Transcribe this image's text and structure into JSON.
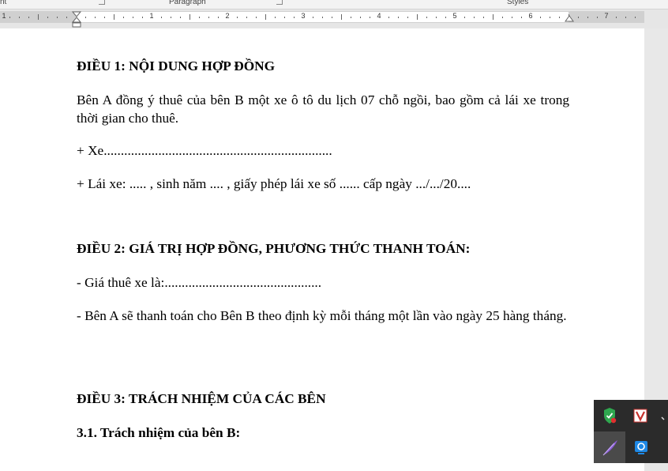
{
  "ribbon": {
    "group_font_partial": "nt",
    "group_paragraph": "Paragraph",
    "group_styles": "Styles"
  },
  "ruler": {
    "numbers": [
      "1",
      "1",
      "2",
      "3",
      "4",
      "5",
      "6",
      "7"
    ]
  },
  "document": {
    "article1_heading": "ĐIỀU 1: NỘI DUNG HỢP ĐỒNG",
    "article1_para": "Bên A đồng ý thuê của bên B một xe ô tô du lịch 07 chỗ ngồi, bao gồm cả lái xe trong thời gian cho thuê.",
    "article1_car": "+ Xe...................................................................",
    "article1_driver": "+ Lái xe: ..... , sinh năm .... , giấy phép lái xe số ......  cấp ngày .../.../20....",
    "article2_heading": "ĐIỀU 2: GIÁ TRỊ HỢP ĐỒNG, PHƯƠNG THỨC THANH TOÁN:",
    "article2_price": "- Giá thuê xe là:..............................................",
    "article2_payment": "- Bên A sẽ thanh toán cho Bên B theo định kỳ mỗi tháng một lần vào ngày 25 hàng tháng.",
    "article3_heading": "ĐIỀU 3: TRÁCH NHIỆM CỦA CÁC BÊN",
    "article3_1_heading": "3.1. Trách nhiệm của bên B:"
  },
  "tray": {
    "icons": [
      "security-shield-icon",
      "vivaldi-v-icon",
      "pen-feather-icon",
      "network-status-icon"
    ]
  },
  "colors": {
    "page_background": "#ffffff",
    "app_background": "#e6e6e6",
    "tray_background": "#2b2b2b"
  }
}
